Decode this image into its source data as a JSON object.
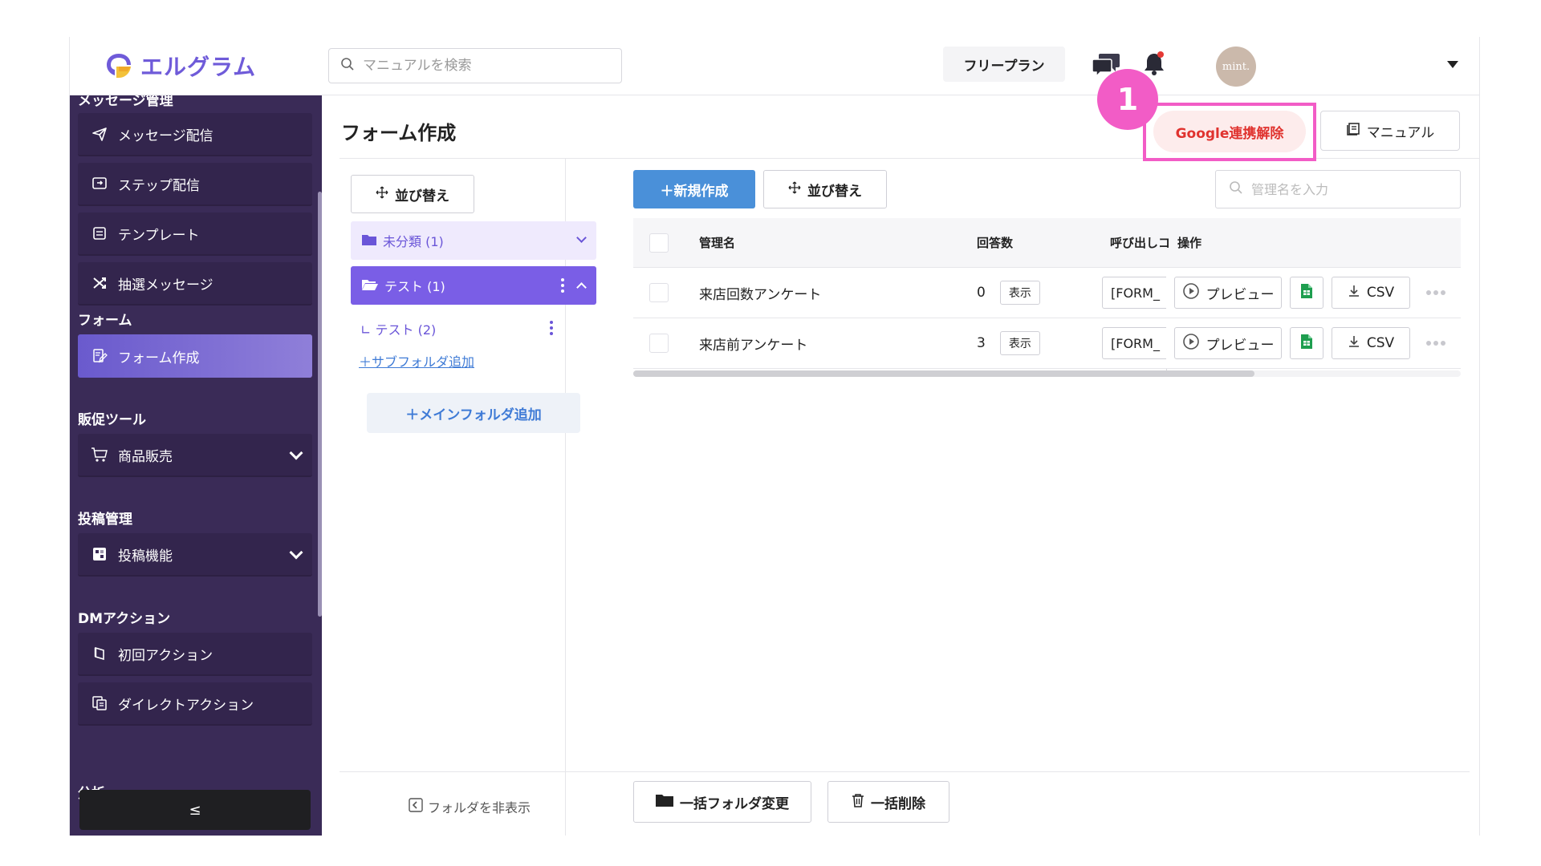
{
  "header": {
    "logo_text": "エルグラム",
    "search_placeholder": "マニュアルを検索",
    "plan_label": "フリープラン",
    "avatar_text": "mint."
  },
  "sidebar": {
    "sections": [
      {
        "label": "メッセージ管理",
        "items": [
          {
            "label": "メッセージ配信",
            "icon": "paper-plane-icon"
          },
          {
            "label": "ステップ配信",
            "icon": "step-icon"
          },
          {
            "label": "テンプレート",
            "icon": "template-icon"
          },
          {
            "label": "抽選メッセージ",
            "icon": "shuffle-icon"
          }
        ]
      },
      {
        "label": "フォーム",
        "items": [
          {
            "label": "フォーム作成",
            "icon": "form-edit-icon",
            "active": true
          }
        ]
      },
      {
        "label": "販促ツール",
        "items": [
          {
            "label": "商品販売",
            "icon": "cart-icon",
            "expandable": true
          }
        ]
      },
      {
        "label": "投稿管理",
        "items": [
          {
            "label": "投稿機能",
            "icon": "post-icon",
            "expandable": true
          }
        ]
      },
      {
        "label": "DMアクション",
        "items": [
          {
            "label": "初回アクション",
            "icon": "first-action-icon"
          },
          {
            "label": "ダイレクトアクション",
            "icon": "direct-action-icon"
          }
        ]
      },
      {
        "label": "分析",
        "items": []
      }
    ],
    "collapse_label": "≤"
  },
  "main": {
    "title": "フォーム作成",
    "google_unlink_label": "Google連携解除",
    "manual_label": "マニュアル",
    "step_number": "1"
  },
  "folders": {
    "sort_label": "並び替え",
    "items": [
      {
        "label": "未分類 (1)"
      },
      {
        "label": "テスト (1)"
      }
    ],
    "sub_item": "テスト (2)",
    "add_sub_label": "サブフォルダ追加",
    "add_main_label": "メインフォルダ追加",
    "hide_label": "フォルダを非表示"
  },
  "content": {
    "new_label": "新規作成",
    "sort_label": "並び替え",
    "search_placeholder": "管理名を入力",
    "table": {
      "headers": {
        "name": "管理名",
        "answers": "回答数",
        "code": "呼び出しコ",
        "ops": "操作"
      },
      "rows": [
        {
          "name": "来店回数アンケート",
          "answers": "0",
          "show": "表示",
          "code": "[FORM_"
        },
        {
          "name": "来店前アンケート",
          "answers": "3",
          "show": "表示",
          "code": "[FORM_"
        }
      ],
      "preview_label": "プレビュー",
      "csv_label": "CSV"
    },
    "bulk_folder_label": "一括フォルダ変更",
    "bulk_delete_label": "一括削除"
  }
}
